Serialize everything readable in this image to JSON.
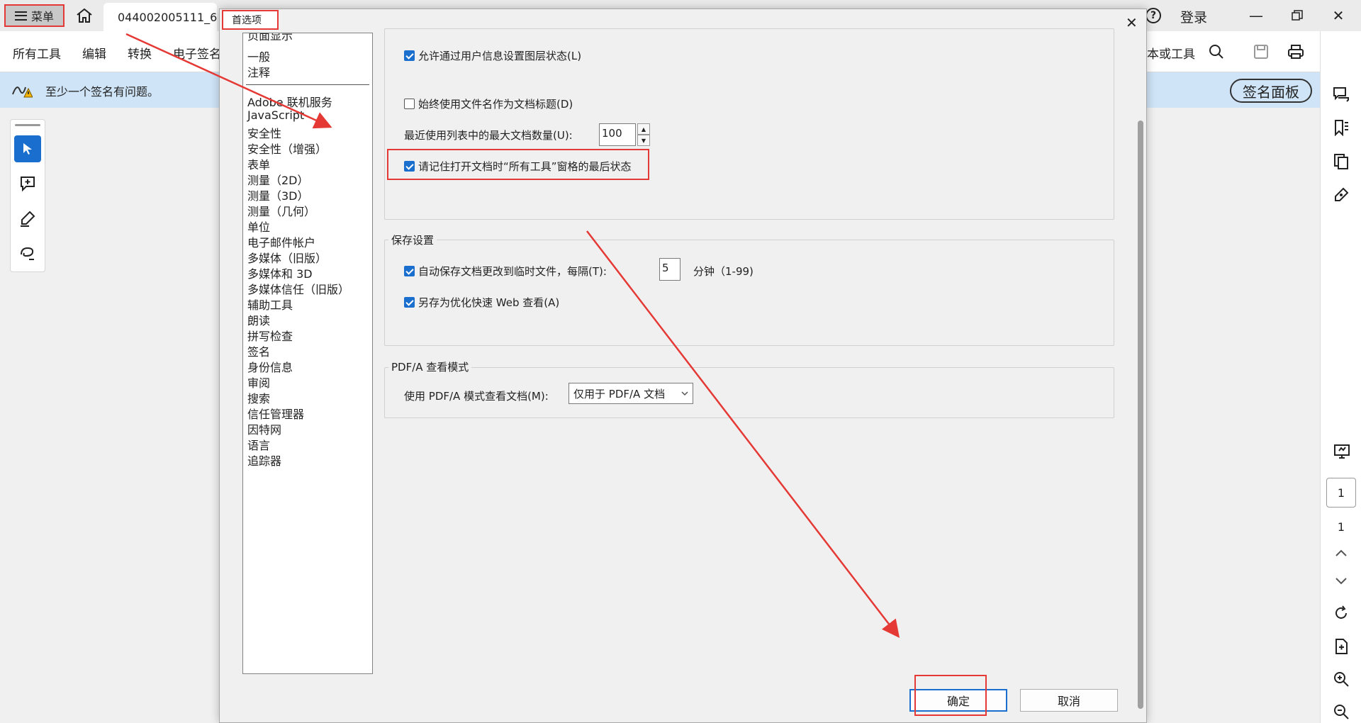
{
  "titlebar": {
    "menu_label": "菜单",
    "doc_tab": "044002005111_6",
    "login": "登录"
  },
  "toolbar": {
    "items": [
      "所有工具",
      "编辑",
      "转换",
      "电子签名"
    ],
    "search_text": "本或工具"
  },
  "notice": {
    "text": "至少一个签名有问题。",
    "sig_panel": "签名面板"
  },
  "rightpanel": {
    "page_current": "1",
    "page_total": "1"
  },
  "dialog": {
    "title": "首选项",
    "categories": [
      "页面显示",
      "一般",
      "注释",
      "Adobe 联机服务",
      "JavaScript",
      "安全性",
      "安全性（增强）",
      "表单",
      "测量（2D）",
      "测量（3D）",
      "测量（几何）",
      "单位",
      "电子邮件帐户",
      "多媒体（旧版）",
      "多媒体和 3D",
      "多媒体信任（旧版）",
      "辅助工具",
      "朗读",
      "拼写检查",
      "签名",
      "身份信息",
      "审阅",
      "搜索",
      "信任管理器",
      "因特网",
      "语言",
      "追踪器"
    ],
    "general": {
      "layer_state": "允许通过用户信息设置图层状态(L)",
      "filename_title": "始终使用文件名作为文档标题(D)",
      "recent_label": "最近使用列表中的最大文档数量(U):",
      "recent_value": "100",
      "remember_tools": "请记住打开文档时“所有工具”窗格的最后状态"
    },
    "save": {
      "label": "保存设置",
      "autosave": "自动保存文档更改到临时文件，每隔(T):",
      "autosave_value": "5",
      "autosave_unit": "分钟（1-99)",
      "fastweb": "另存为优化快速 Web 查看(A)"
    },
    "pdfa": {
      "label": "PDF/A 查看模式",
      "mode_label": "使用 PDF/A 模式查看文档(M):",
      "mode_value": "仅用于 PDF/A 文档"
    },
    "ok": "确定",
    "cancel": "取消"
  },
  "colors": {
    "highlight": "#e53935",
    "accent": "#1a6fce",
    "notice_bg": "#cfe4f7"
  }
}
